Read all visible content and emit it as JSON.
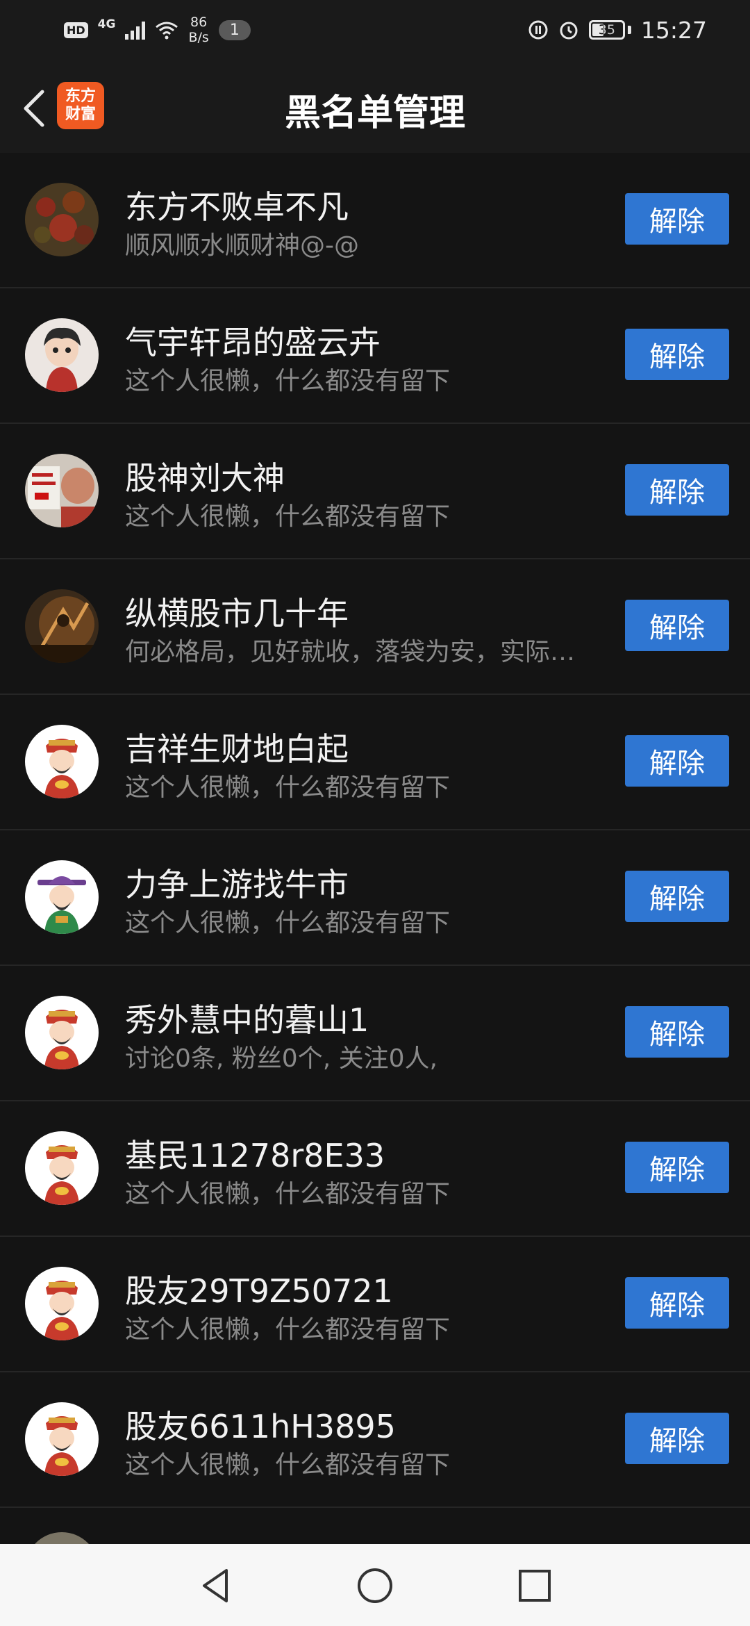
{
  "status_bar": {
    "hd": "HD",
    "network": "4G",
    "speed_value": "86",
    "speed_unit": "B/s",
    "notification_count": "1",
    "battery": "35",
    "time": "15:27"
  },
  "header": {
    "logo_line1": "东方",
    "logo_line2": "财富",
    "title": "黑名单管理"
  },
  "button_label": "解除",
  "users": [
    {
      "name": "东方不败卓不凡",
      "subtitle": "顺风顺水顺财神@-@",
      "avatar": "photo-red-berries"
    },
    {
      "name": "气宇轩昂的盛云卉",
      "subtitle": "这个人很懒，什么都没有留下",
      "avatar": "cartoon-boy"
    },
    {
      "name": "股神刘大神",
      "subtitle": "这个人很懒，什么都没有留下",
      "avatar": "photo-man-sign"
    },
    {
      "name": "纵横股市几十年",
      "subtitle": "何必格局，见好就收，落袋为安，实际…",
      "avatar": "photo-archer"
    },
    {
      "name": "吉祥生财地白起",
      "subtitle": "这个人很懒，什么都没有留下",
      "avatar": "caishen-red"
    },
    {
      "name": "力争上游找牛市",
      "subtitle": "这个人很懒，什么都没有留下",
      "avatar": "caishen-purple"
    },
    {
      "name": "秀外慧中的暮山1",
      "subtitle": "讨论0条, 粉丝0个, 关注0人,",
      "avatar": "caishen-red"
    },
    {
      "name": "基民11278r8E33",
      "subtitle": "这个人很懒，什么都没有留下",
      "avatar": "caishen-red"
    },
    {
      "name": "股友29T9Z50721",
      "subtitle": "这个人很懒，什么都没有留下",
      "avatar": "caishen-red"
    },
    {
      "name": "股友6611hH3895",
      "subtitle": "这个人很懒，什么都没有留下",
      "avatar": "caishen-red"
    }
  ],
  "colors": {
    "background": "#141414",
    "button": "#2f76d2",
    "logo": "#f05a22"
  }
}
